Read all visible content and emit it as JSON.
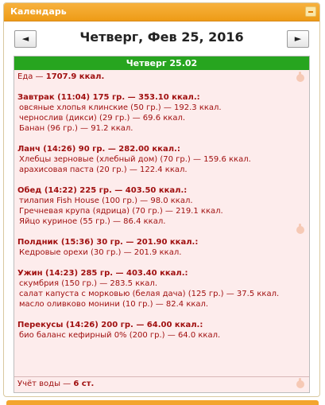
{
  "widget": {
    "title": "Календарь"
  },
  "nav": {
    "prev": "◄",
    "next": "►",
    "date_title": "Четверг, Фев 25, 2016"
  },
  "day": {
    "header": "Четверг 25.02",
    "food_label": "Еда —",
    "food_total": "1707.9 ккал.",
    "meals": [
      {
        "title": "Завтрак (11:04) 175 гр. — 353.10 ккал.:",
        "items": [
          "овсяные хлопья клинские (50 гр.) — 192.3 ккал.",
          "чернослив (дикси) (29 гр.) — 69.6 ккал.",
          "Банан (96 гр.) — 91.2 ккал."
        ]
      },
      {
        "title": "Ланч (14:26) 90 гр. — 282.00 ккал.:",
        "items": [
          "Хлебцы зерновые (хлебный дом) (70 гр.) — 159.6 ккал.",
          "арахисовая паста (20 гр.) — 122.4 ккал."
        ]
      },
      {
        "title": "Обед (14:22) 225 гр. — 403.50 ккал.:",
        "items": [
          "тилапия Fish House (100 гр.) — 98.0 ккал.",
          "Гречневая крупа (ядрица) (70 гр.) — 219.1 ккал.",
          "Яйцо куриное (55 гр.) — 86.4 ккал."
        ]
      },
      {
        "title": "Полдник (15:36) 30 гр. — 201.90 ккал.:",
        "items": [
          "Кедровые орехи (30 гр.) — 201.9 ккал."
        ]
      },
      {
        "title": "Ужин (14:23) 285 гр. — 403.40 ккал.:",
        "items": [
          "скумбрия (150 гр.) — 283.5 ккал.",
          "салат капуста с морковью (белая дача) (125 гр.) — 37.5 ккал.",
          "масло оливково монини (10 гр.) — 82.4 ккал."
        ]
      },
      {
        "title": "Перекусы (14:26) 200 гр. — 64.00 ккал.:",
        "items": [
          "био баланс кефирный 0% (200 гр.) — 64.0 ккал."
        ]
      }
    ],
    "water_label": "Учёт воды —",
    "water_value": "6 ст."
  },
  "colors": {
    "header_orange": "#ee9b16",
    "day_green": "#27a51f",
    "text_red": "#a01010",
    "body_pink": "#fdecec"
  },
  "icons": {
    "collapse": "minus-icon",
    "hand": "hand-pointer-icon"
  }
}
